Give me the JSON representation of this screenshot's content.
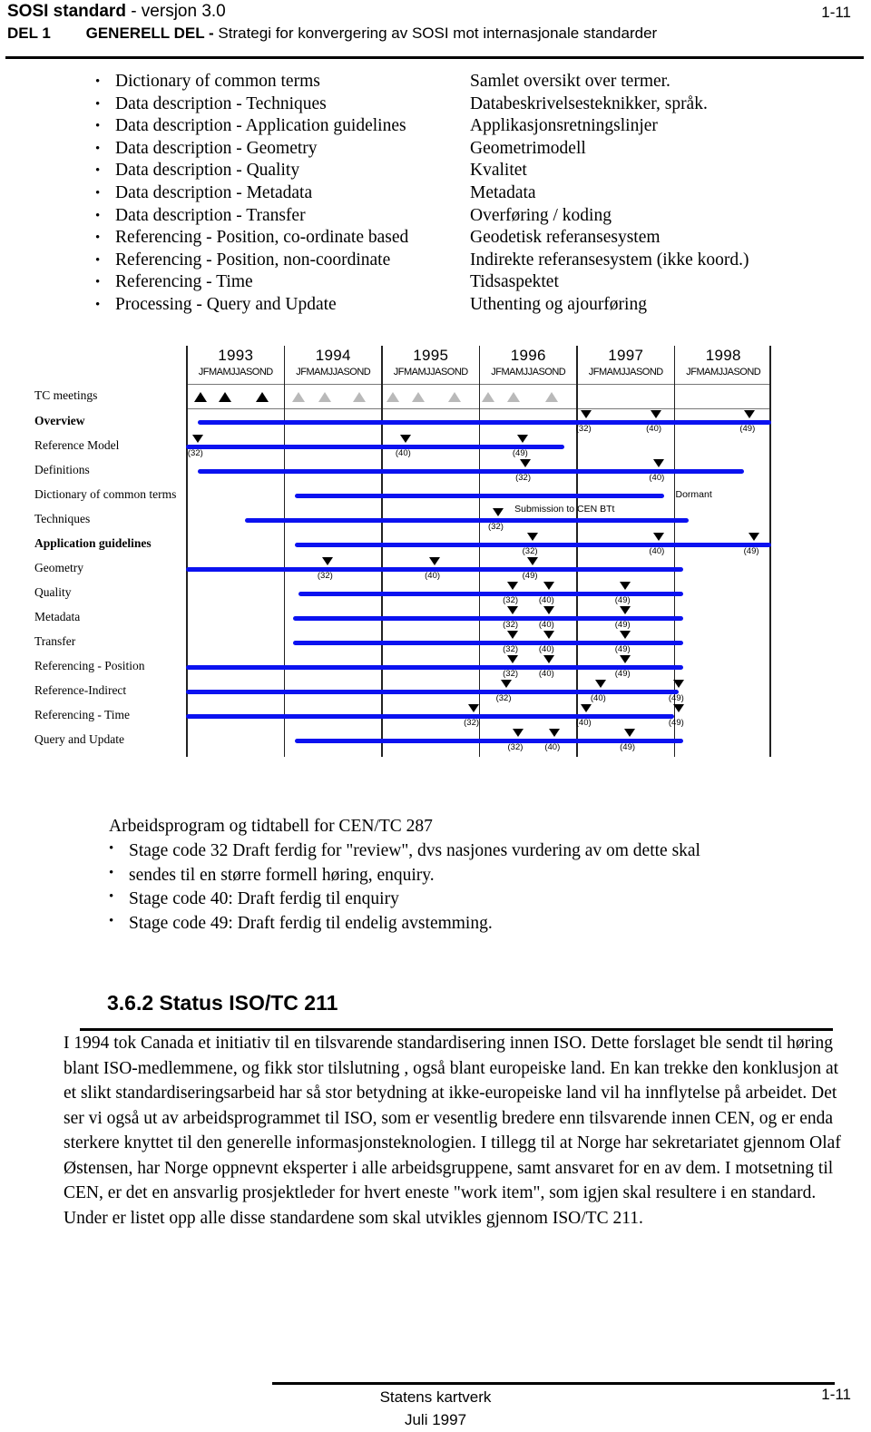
{
  "header": {
    "doc_title_bold": "SOSI standard",
    "doc_title_rest": " - versjon 3.0",
    "page_number": "1-11",
    "part_label": "DEL 1",
    "part_title_bold": "GENERELL DEL - ",
    "part_title_rest": "Strategi for konvergering av SOSI mot internasjonale standarder"
  },
  "term_list": {
    "bullet": "•",
    "rows": [
      {
        "en": "Dictionary of common terms",
        "no": "Samlet oversikt over termer."
      },
      {
        "en": "Data description - Techniques",
        "no": "Databeskrivelsesteknikker, språk."
      },
      {
        "en": "Data description - Application guidelines",
        "no": "Applikasjonsretningslinjer"
      },
      {
        "en": "Data description - Geometry",
        "no": "Geometrimodell"
      },
      {
        "en": "Data description - Quality",
        "no": "Kvalitet"
      },
      {
        "en": "Data description - Metadata",
        "no": "Metadata"
      },
      {
        "en": "Data description - Transfer",
        "no": "Overføring / koding"
      },
      {
        "en": "Referencing - Position, co-ordinate based",
        "no": "Geodetisk referansesystem"
      },
      {
        "en": "Referencing - Position, non-coordinate",
        "no": "Indirekte referansesystem  (ikke koord.)"
      },
      {
        "en": "Referencing - Time",
        "no": "Tidsaspektet"
      },
      {
        "en": "Processing - Query and Update",
        "no": "Uthenting og ajourføring"
      }
    ]
  },
  "chart_data": {
    "type": "gantt",
    "title": "Arbeidsprogram og tidtabell for CEN/TC 287",
    "xlabel": "",
    "ylabel": "",
    "months_label": "JFMAMJJASOND",
    "years": [
      "1993",
      "1994",
      "1995",
      "1996",
      "1997",
      "1998"
    ],
    "xlim": [
      1993.0,
      1999.0
    ],
    "grid": true,
    "legend": "none",
    "stage_codes": [
      "(32)",
      "(40)",
      "(49)"
    ],
    "tc_meetings": {
      "row_label": "TC meetings",
      "markers": [
        {
          "x": 1993.15,
          "filled": true
        },
        {
          "x": 1993.4,
          "filled": true
        },
        {
          "x": 1993.78,
          "filled": true
        },
        {
          "x": 1994.15,
          "filled": false
        },
        {
          "x": 1994.42,
          "filled": false
        },
        {
          "x": 1994.78,
          "filled": false
        },
        {
          "x": 1995.12,
          "filled": false
        },
        {
          "x": 1995.38,
          "filled": false
        },
        {
          "x": 1995.75,
          "filled": false
        },
        {
          "x": 1996.1,
          "filled": false
        },
        {
          "x": 1996.36,
          "filled": false
        },
        {
          "x": 1996.75,
          "filled": false
        }
      ]
    },
    "rows": [
      {
        "label": "Overview",
        "bold": true,
        "start": 1993.12,
        "end": 1999.0,
        "milestones": [
          {
            "x": 1997.1,
            "code": "(32)"
          },
          {
            "x": 1997.82,
            "code": "(40)"
          },
          {
            "x": 1998.78,
            "code": "(49)"
          }
        ],
        "notes": []
      },
      {
        "label": "Reference Model",
        "bold": false,
        "start": 1993.0,
        "end": 1996.88,
        "milestones": [
          {
            "x": 1993.12,
            "code": "(32)"
          },
          {
            "x": 1995.25,
            "code": "(40)"
          },
          {
            "x": 1996.45,
            "code": "(49)"
          }
        ],
        "notes": []
      },
      {
        "label": "Definitions",
        "bold": false,
        "start": 1993.12,
        "end": 1998.72,
        "milestones": [
          {
            "x": 1996.48,
            "code": "(32)"
          },
          {
            "x": 1997.85,
            "code": "(40)"
          }
        ],
        "notes": []
      },
      {
        "label": "Dictionary of common terms",
        "bold": false,
        "start": 1994.12,
        "end": 1997.9,
        "milestones": [],
        "notes": [
          {
            "x": 1998.0,
            "text": "Dormant"
          }
        ]
      },
      {
        "label": "Techniques",
        "bold": false,
        "start": 1993.6,
        "end": 1998.15,
        "milestones": [
          {
            "x": 1996.2,
            "code": "(32)"
          }
        ],
        "notes": [
          {
            "x": 1996.35,
            "text": "Submission to CEN BTt"
          }
        ]
      },
      {
        "label": "Application guidelines",
        "bold": true,
        "start": 1994.12,
        "end": 1999.0,
        "milestones": [
          {
            "x": 1996.55,
            "code": "(32)"
          },
          {
            "x": 1997.85,
            "code": "(40)"
          },
          {
            "x": 1998.82,
            "code": "(49)"
          }
        ],
        "notes": []
      },
      {
        "label": "Geometry",
        "bold": false,
        "start": 1992.95,
        "end": 1998.1,
        "milestones": [
          {
            "x": 1994.45,
            "code": "(32)"
          },
          {
            "x": 1995.55,
            "code": "(40)"
          },
          {
            "x": 1996.55,
            "code": "(49)"
          }
        ],
        "notes": []
      },
      {
        "label": "Quality",
        "bold": false,
        "start": 1994.15,
        "end": 1998.1,
        "milestones": [
          {
            "x": 1996.35,
            "code": "(32)"
          },
          {
            "x": 1996.72,
            "code": "(40)"
          },
          {
            "x": 1997.5,
            "code": "(49)"
          }
        ],
        "notes": []
      },
      {
        "label": "Metadata",
        "bold": false,
        "start": 1994.1,
        "end": 1998.1,
        "milestones": [
          {
            "x": 1996.35,
            "code": "(32)"
          },
          {
            "x": 1996.72,
            "code": "(40)"
          },
          {
            "x": 1997.5,
            "code": "(49)"
          }
        ],
        "notes": []
      },
      {
        "label": "Transfer",
        "bold": false,
        "start": 1994.1,
        "end": 1998.1,
        "milestones": [
          {
            "x": 1996.35,
            "code": "(32)"
          },
          {
            "x": 1996.72,
            "code": "(40)"
          },
          {
            "x": 1997.5,
            "code": "(49)"
          }
        ],
        "notes": []
      },
      {
        "label": "Referencing - Position",
        "bold": false,
        "start": 1992.95,
        "end": 1998.1,
        "milestones": [
          {
            "x": 1996.35,
            "code": "(32)"
          },
          {
            "x": 1996.72,
            "code": "(40)"
          },
          {
            "x": 1997.5,
            "code": "(49)"
          }
        ],
        "notes": []
      },
      {
        "label": "Reference-Indirect",
        "bold": false,
        "start": 1993.0,
        "end": 1998.05,
        "milestones": [
          {
            "x": 1996.28,
            "code": "(32)"
          },
          {
            "x": 1997.25,
            "code": "(40)"
          },
          {
            "x": 1998.05,
            "code": "(49)"
          }
        ],
        "notes": []
      },
      {
        "label": "Referencing - Time",
        "bold": false,
        "start": 1992.95,
        "end": 1998.0,
        "milestones": [
          {
            "x": 1995.95,
            "code": "(32)"
          },
          {
            "x": 1997.1,
            "code": "(40)"
          },
          {
            "x": 1998.05,
            "code": "(49)"
          }
        ],
        "notes": []
      },
      {
        "label": "Query and Update",
        "bold": false,
        "start": 1994.12,
        "end": 1998.1,
        "milestones": [
          {
            "x": 1996.4,
            "code": "(32)"
          },
          {
            "x": 1996.78,
            "code": "(40)"
          },
          {
            "x": 1997.55,
            "code": "(49)"
          }
        ],
        "notes": []
      }
    ]
  },
  "lower": {
    "title": "Arbeidsprogram og tidtabell for CEN/TC 287",
    "bullet": "•",
    "items": [
      "Stage code 32 Draft ferdig for \"review\", dvs nasjones vurdering av om dette skal",
      "sendes til en større formell høring, enquiry.",
      "Stage code 40: Draft ferdig til enquiry",
      "Stage code 49: Draft ferdig til endelig avstemming."
    ]
  },
  "section": {
    "heading": "3.6.2  Status ISO/TC 211",
    "paragraph": "I 1994 tok Canada et initiativ til en tilsvarende standardisering innen ISO. Dette forslaget ble sendt til høring blant ISO-medlemmene, og fikk stor tilslutning , også blant europeiske land. En kan trekke den konklusjon at et slikt standardiseringsarbeid har så stor betydning at ikke-europeiske land vil ha innflytelse på arbeidet. Det ser vi også ut av arbeidsprogrammet til ISO, som er vesentlig bredere enn tilsvarende innen CEN, og er enda sterkere knyttet til den generelle informasjonsteknologien. I tillegg til at Norge har sekretariatet gjennom Olaf Østensen, har Norge oppnevnt eksperter i alle arbeidsgruppene, samt ansvaret for en av dem. I motsetning til CEN, er det en ansvarlig prosjektleder for hvert eneste \"work item\", som igjen skal resultere i en standard. Under er listet opp alle disse standardene som skal utvikles gjennom ISO/TC 211."
  },
  "footer": {
    "org": "Statens kartverk",
    "date": "Juli 1997",
    "page_number": "1-11"
  },
  "colors": {
    "bar": "#0b12f0",
    "milestone": "#000000",
    "tc_meeting_filled": "#000000",
    "tc_meeting_empty": "#b9b9b9"
  }
}
